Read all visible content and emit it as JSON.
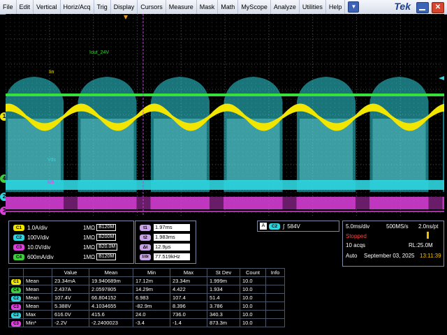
{
  "menu": {
    "items": [
      "File",
      "Edit",
      "Vertical",
      "Horiz/Acq",
      "Trig",
      "Display",
      "Cursors",
      "Measure",
      "Mask",
      "Math",
      "MyScope",
      "Analyze",
      "Utilities",
      "Help"
    ],
    "dropdown_glyph": "▼",
    "brand": "Tek",
    "close_glyph": "✕"
  },
  "colors": {
    "ch1": "#f2e600",
    "ch2": "#2fd6e0",
    "ch3": "#e040e0",
    "ch4": "#3ccf3c"
  },
  "waveform_labels": {
    "iout": "Iout_24V",
    "iin": "Iin",
    "vds": "Vds",
    "ich3": "Ich"
  },
  "markers": {
    "ch1": "1",
    "ch4": "4",
    "ch2": "2",
    "ch3": "3"
  },
  "channels": [
    {
      "badge": "C1",
      "scale": "1.0A/div",
      "imp": "1MΩ",
      "bw": "120M",
      "color": "#f2e600"
    },
    {
      "badge": "C2",
      "scale": "100V/div",
      "imp": "1MΩ",
      "bw": "200M",
      "color": "#2fd6e0"
    },
    {
      "badge": "C3",
      "scale": "10.0V/div",
      "imp": "1MΩ",
      "bw": "20.0M",
      "color": "#e040e0"
    },
    {
      "badge": "C4",
      "scale": "600mA/div",
      "imp": "1MΩ",
      "bw": "120M",
      "color": "#3ccf3c"
    }
  ],
  "bw_prefix": "B",
  "cursors": [
    {
      "badge": "t1",
      "value": "1.97ms"
    },
    {
      "badge": "t2",
      "value": "1.983ms"
    },
    {
      "badge": "Δt",
      "value": "12.9µs"
    },
    {
      "badge": "1/Δt",
      "value": "77.519kHz"
    }
  ],
  "trigger": {
    "source": "A",
    "channel": "C2",
    "slope": "∫",
    "level": "584V"
  },
  "acquisition": {
    "timebase": "5.0ms/div",
    "sample_rate": "500MS/s",
    "resolution": "2.0ns/pt",
    "state": "Stopped",
    "acqs": "10 acqs",
    "record_length": "RL:25.0M",
    "mode": "Auto",
    "date": "September 03, 2025",
    "time": "13:11:39"
  },
  "measurements": {
    "headers": [
      "",
      "",
      "Value",
      "Mean",
      "Min",
      "Max",
      "St Dev",
      "Count",
      "Info"
    ],
    "rows": [
      {
        "ch": "C1",
        "color": "#f2e600",
        "type": "Mean",
        "value": "23.34mA",
        "mean": "19.940689m",
        "min": "17.12m",
        "max": "23.34m",
        "stdev": "1.999m",
        "count": "10.0",
        "info": ""
      },
      {
        "ch": "C4",
        "color": "#3ccf3c",
        "type": "Mean",
        "value": "2.437A",
        "mean": "2.0597805",
        "min": "14.29m",
        "max": "4.422",
        "stdev": "1.934",
        "count": "10.0",
        "info": ""
      },
      {
        "ch": "C2",
        "color": "#2fd6e0",
        "type": "Mean",
        "value": "107.4V",
        "mean": "66.804152",
        "min": "6.983",
        "max": "107.4",
        "stdev": "51.4",
        "count": "10.0",
        "info": ""
      },
      {
        "ch": "C3",
        "color": "#e040e0",
        "type": "Mean",
        "value": "5.388V",
        "mean": "4.1034655",
        "min": "-82.9m",
        "max": "8.396",
        "stdev": "3.786",
        "count": "10.0",
        "info": ""
      },
      {
        "ch": "C2",
        "color": "#2fd6e0",
        "type": "Max",
        "value": "616.0V",
        "mean": "415.6",
        "min": "24.0",
        "max": "736.0",
        "stdev": "340.3",
        "count": "10.0",
        "info": ""
      },
      {
        "ch": "C3",
        "color": "#e040e0",
        "type": "Min*",
        "value": "-2.2V",
        "mean": "-2.2400023",
        "min": "-3.4",
        "max": "-1.4",
        "stdev": "873.3m",
        "count": "10.0",
        "info": ""
      }
    ]
  }
}
